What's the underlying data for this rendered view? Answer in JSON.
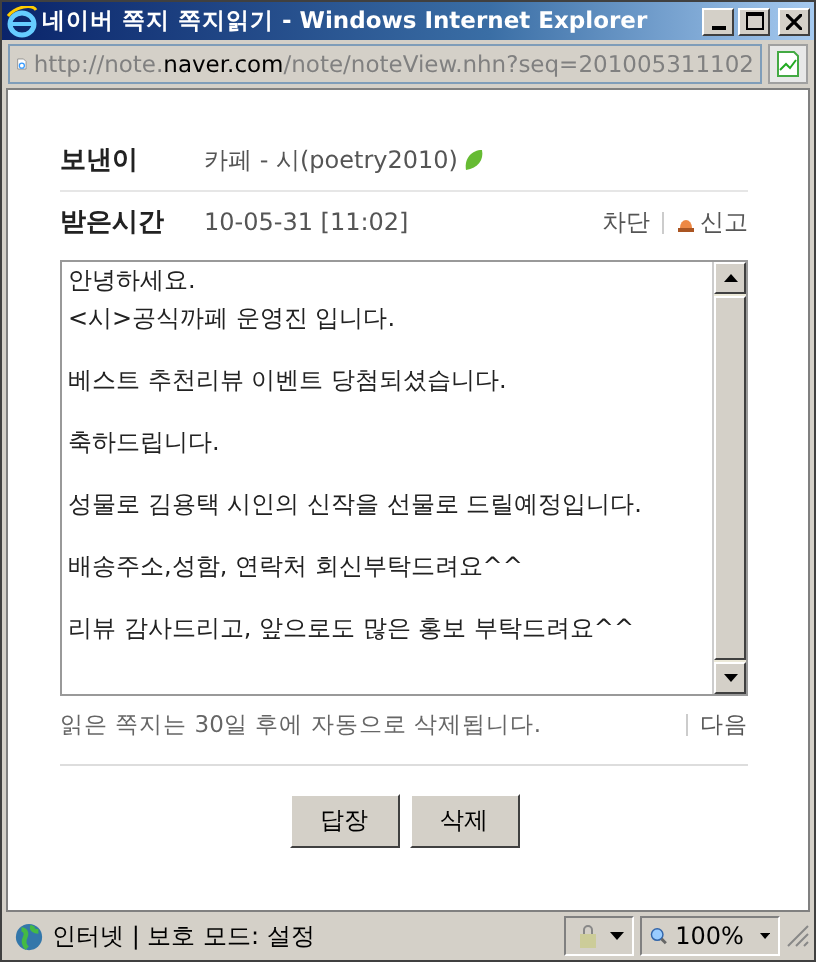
{
  "window": {
    "title": "네이버 쪽지 쪽지읽기 - Windows Internet Explorer"
  },
  "address_bar": {
    "prefix": "http://note.",
    "host": "naver.com",
    "path": "/note/noteView.nhn?seq=201005311102"
  },
  "sender": {
    "label": "보낸이",
    "value": "카페 - 시(poetry2010)"
  },
  "received": {
    "label": "받은시간",
    "value": "10-05-31 [11:02]"
  },
  "actions": [
    "차단",
    "신고"
  ],
  "message": {
    "paragraphs": [
      [
        "안녕하세요.",
        "<시>공식까페 운영진 입니다."
      ],
      [
        "베스트 추천리뷰 이벤트 당첨되셨습니다."
      ],
      [
        "축하드립니다."
      ],
      [
        "성물로 김용택 시인의 신작을 선물로 드릴예정입니다."
      ],
      [
        "배송주소,성함, 연락처 회신부탁드려요^^"
      ],
      [
        "리뷰 감사드리고, 앞으로도 많은 홍보 부탁드려요^^"
      ]
    ]
  },
  "notice": "읽은 쪽지는 30일 후에 자동으로 삭제됩니다.",
  "next_link": "다음",
  "buttons": [
    "답장",
    "삭제"
  ],
  "status_bar": {
    "zone": "인터넷 | 보호 모드: 설정",
    "zoom": "100%"
  }
}
